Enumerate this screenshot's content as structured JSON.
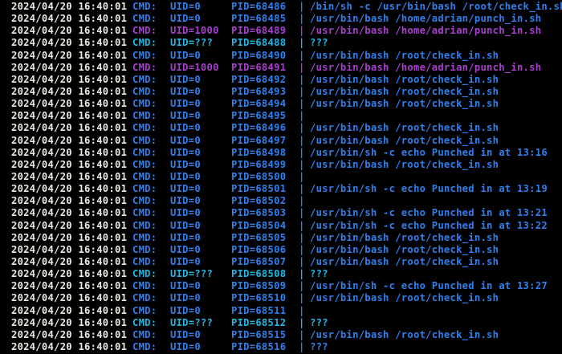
{
  "terminal": {
    "timestamp_color": "#ece9e0",
    "lines": [
      {
        "ts": "2024/04/20 16:40:01",
        "cmd": "CMD:",
        "uid": "UID=0",
        "pid": "PID=68486",
        "sep": "|",
        "proc": "/bin/sh -c /usr/bin/bash /root/check_in.sh",
        "color": "#2f80ed"
      },
      {
        "ts": "2024/04/20 16:40:01",
        "cmd": "CMD:",
        "uid": "UID=0",
        "pid": "PID=68485",
        "sep": "|",
        "proc": "/usr/bin/bash /home/adrian/punch_in.sh",
        "color": "#2f80ed"
      },
      {
        "ts": "2024/04/20 16:40:01",
        "cmd": "CMD:",
        "uid": "UID=1000",
        "pid": "PID=68489",
        "sep": "|",
        "proc": "/usr/bin/bash /home/adrian/punch_in.sh",
        "color": "#a83fcf"
      },
      {
        "ts": "2024/04/20 16:40:01",
        "cmd": "CMD:",
        "uid": "UID=???",
        "pid": "PID=68488",
        "sep": "|",
        "proc": "???",
        "color": "#1fb8e6"
      },
      {
        "ts": "2024/04/20 16:40:01",
        "cmd": "CMD:",
        "uid": "UID=0",
        "pid": "PID=68490",
        "sep": "|",
        "proc": "/usr/bin/bash /root/check_in.sh",
        "color": "#2f80ed"
      },
      {
        "ts": "2024/04/20 16:40:01",
        "cmd": "CMD:",
        "uid": "UID=1000",
        "pid": "PID=68491",
        "sep": "|",
        "proc": "/usr/bin/bash /home/adrian/punch_in.sh",
        "color": "#a83fcf"
      },
      {
        "ts": "2024/04/20 16:40:01",
        "cmd": "CMD:",
        "uid": "UID=0",
        "pid": "PID=68492",
        "sep": "|",
        "proc": "/usr/bin/bash /root/check_in.sh",
        "color": "#2f80ed"
      },
      {
        "ts": "2024/04/20 16:40:01",
        "cmd": "CMD:",
        "uid": "UID=0",
        "pid": "PID=68493",
        "sep": "|",
        "proc": "/usr/bin/bash /root/check_in.sh",
        "color": "#2f80ed"
      },
      {
        "ts": "2024/04/20 16:40:01",
        "cmd": "CMD:",
        "uid": "UID=0",
        "pid": "PID=68494",
        "sep": "|",
        "proc": "/usr/bin/bash /root/check_in.sh",
        "color": "#2f80ed"
      },
      {
        "ts": "2024/04/20 16:40:01",
        "cmd": "CMD:",
        "uid": "UID=0",
        "pid": "PID=68495",
        "sep": "|",
        "proc": "",
        "color": "#2f80ed"
      },
      {
        "ts": "2024/04/20 16:40:01",
        "cmd": "CMD:",
        "uid": "UID=0",
        "pid": "PID=68496",
        "sep": "|",
        "proc": "/usr/bin/bash /root/check_in.sh",
        "color": "#2f80ed"
      },
      {
        "ts": "2024/04/20 16:40:01",
        "cmd": "CMD:",
        "uid": "UID=0",
        "pid": "PID=68497",
        "sep": "|",
        "proc": "/usr/bin/bash /root/check_in.sh",
        "color": "#2f80ed"
      },
      {
        "ts": "2024/04/20 16:40:01",
        "cmd": "CMD:",
        "uid": "UID=0",
        "pid": "PID=68498",
        "sep": "|",
        "proc": "/usr/bin/sh -c echo Punched in at 13:16",
        "color": "#2f80ed"
      },
      {
        "ts": "2024/04/20 16:40:01",
        "cmd": "CMD:",
        "uid": "UID=0",
        "pid": "PID=68499",
        "sep": "|",
        "proc": "/usr/bin/bash /root/check_in.sh",
        "color": "#2f80ed"
      },
      {
        "ts": "2024/04/20 16:40:01",
        "cmd": "CMD:",
        "uid": "UID=0",
        "pid": "PID=68500",
        "sep": "|",
        "proc": "",
        "color": "#2f80ed"
      },
      {
        "ts": "2024/04/20 16:40:01",
        "cmd": "CMD:",
        "uid": "UID=0",
        "pid": "PID=68501",
        "sep": "|",
        "proc": "/usr/bin/sh -c echo Punched in at 13:19",
        "color": "#2f80ed"
      },
      {
        "ts": "2024/04/20 16:40:01",
        "cmd": "CMD:",
        "uid": "UID=0",
        "pid": "PID=68502",
        "sep": "|",
        "proc": "",
        "color": "#2f80ed"
      },
      {
        "ts": "2024/04/20 16:40:01",
        "cmd": "CMD:",
        "uid": "UID=0",
        "pid": "PID=68503",
        "sep": "|",
        "proc": "/usr/bin/sh -c echo Punched in at 13:21",
        "color": "#2f80ed"
      },
      {
        "ts": "2024/04/20 16:40:01",
        "cmd": "CMD:",
        "uid": "UID=0",
        "pid": "PID=68504",
        "sep": "|",
        "proc": "/usr/bin/sh -c echo Punched in at 13:22",
        "color": "#2f80ed"
      },
      {
        "ts": "2024/04/20 16:40:01",
        "cmd": "CMD:",
        "uid": "UID=0",
        "pid": "PID=68505",
        "sep": "|",
        "proc": "/usr/bin/bash /root/check_in.sh",
        "color": "#2f80ed"
      },
      {
        "ts": "2024/04/20 16:40:01",
        "cmd": "CMD:",
        "uid": "UID=0",
        "pid": "PID=68506",
        "sep": "|",
        "proc": "/usr/bin/bash /root/check_in.sh",
        "color": "#2f80ed"
      },
      {
        "ts": "2024/04/20 16:40:01",
        "cmd": "CMD:",
        "uid": "UID=0",
        "pid": "PID=68507",
        "sep": "|",
        "proc": "/usr/bin/bash /root/check_in.sh",
        "color": "#2f80ed"
      },
      {
        "ts": "2024/04/20 16:40:01",
        "cmd": "CMD:",
        "uid": "UID=???",
        "pid": "PID=68508",
        "sep": "|",
        "proc": "???",
        "color": "#1fb8e6"
      },
      {
        "ts": "2024/04/20 16:40:01",
        "cmd": "CMD:",
        "uid": "UID=0",
        "pid": "PID=68509",
        "sep": "|",
        "proc": "/usr/bin/sh -c echo Punched in at 13:27",
        "color": "#2f80ed"
      },
      {
        "ts": "2024/04/20 16:40:01",
        "cmd": "CMD:",
        "uid": "UID=0",
        "pid": "PID=68510",
        "sep": "|",
        "proc": "/usr/bin/bash /root/check_in.sh",
        "color": "#2f80ed"
      },
      {
        "ts": "2024/04/20 16:40:01",
        "cmd": "CMD:",
        "uid": "UID=0",
        "pid": "PID=68511",
        "sep": "|",
        "proc": "",
        "color": "#2f80ed"
      },
      {
        "ts": "2024/04/20 16:40:01",
        "cmd": "CMD:",
        "uid": "UID=???",
        "pid": "PID=68512",
        "sep": "|",
        "proc": "???",
        "color": "#1fb8e6"
      },
      {
        "ts": "2024/04/20 16:40:01",
        "cmd": "CMD:",
        "uid": "UID=0",
        "pid": "PID=68515",
        "sep": "|",
        "proc": "/usr/bin/bash /root/check_in.sh",
        "color": "#2f80ed"
      },
      {
        "ts": "2024/04/20 16:40:01",
        "cmd": "CMD:",
        "uid": "UID=0",
        "pid": "PID=68516",
        "sep": "|",
        "proc": "???",
        "color": "#2f80ed"
      }
    ]
  }
}
